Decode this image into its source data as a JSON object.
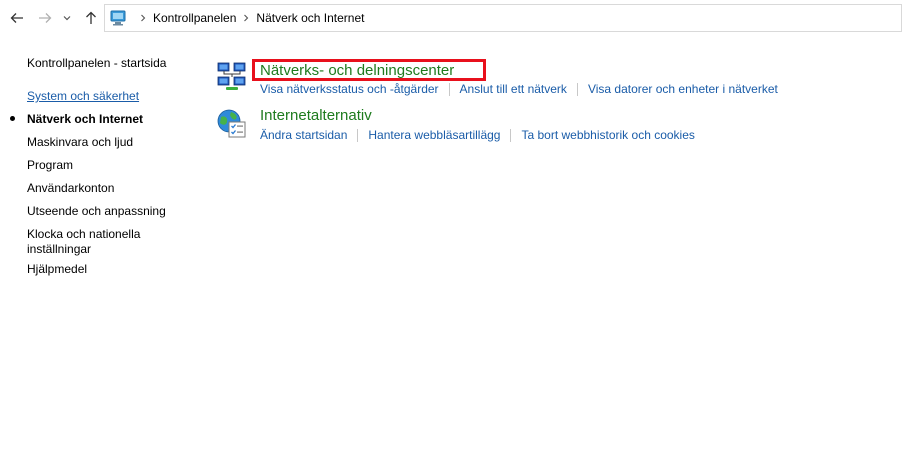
{
  "address_bar": {
    "breadcrumbs": [
      "Kontrollpanelen",
      "Nätverk och Internet"
    ],
    "location_icon": "control-panel-icon"
  },
  "nav": {
    "back_icon": "arrow-left-icon",
    "forward_icon": "arrow-right-icon",
    "recent_icon": "chevron-down-icon",
    "up_icon": "arrow-up-icon"
  },
  "sidebar": {
    "home": "Kontrollpanelen - startsida",
    "items": [
      "System och säkerhet",
      "Nätverk och Internet",
      "Maskinvara och ljud",
      "Program",
      "Användarkonton",
      "Utseende och anpassning",
      "Klocka och nationella",
      "inställningar",
      "Hjälpmedel"
    ],
    "current_index": 1
  },
  "categories": [
    {
      "title": "Nätverks- och delningscenter",
      "icon": "network-sharing-icon",
      "tasks": [
        "Visa nätverksstatus och -åtgärder",
        "Anslut till ett nätverk",
        "Visa datorer och enheter i nätverket"
      ]
    },
    {
      "title": "Internetalternativ",
      "icon": "internet-options-icon",
      "tasks": [
        "Ändra startsidan",
        "Hantera webbläsartillägg",
        "Ta bort webbhistorik och cookies"
      ]
    }
  ],
  "colors": {
    "link": "#1a5ca8",
    "category_title": "#1e7b1e",
    "highlight": "#e8101c"
  }
}
